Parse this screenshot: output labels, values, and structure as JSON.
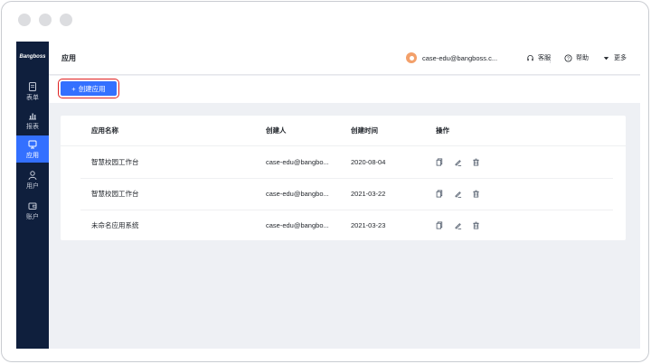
{
  "sidebar": {
    "logo": "Bangboss",
    "items": [
      {
        "label": "表单",
        "icon": "form-icon"
      },
      {
        "label": "报表",
        "icon": "chart-icon"
      },
      {
        "label": "应用",
        "icon": "app-icon",
        "active": true
      },
      {
        "label": "用户",
        "icon": "user-icon"
      },
      {
        "label": "账户",
        "icon": "wallet-icon"
      }
    ]
  },
  "header": {
    "title": "应用",
    "user_email": "case-edu@bangboss.c...",
    "service_label": "客服",
    "help_label": "帮助",
    "more_label": "更多"
  },
  "toolbar": {
    "create_label": "创建应用"
  },
  "table": {
    "columns": [
      "应用名称",
      "创建人",
      "创建时间",
      "操作"
    ],
    "rows": [
      {
        "name": "智慧校园工作台",
        "creator": "case-edu@bangbo...",
        "created": "2020-08-04"
      },
      {
        "name": "智慧校园工作台",
        "creator": "case-edu@bangbo...",
        "created": "2021-03-22"
      },
      {
        "name": "未命名应用系统",
        "creator": "case-edu@bangbo...",
        "created": "2021-03-23"
      }
    ],
    "row_actions": [
      "copy-icon",
      "edit-icon",
      "delete-icon"
    ]
  },
  "colors": {
    "accent": "#3370ff",
    "sidebar_bg": "#0f1f3d",
    "highlight_border": "#e02020"
  }
}
